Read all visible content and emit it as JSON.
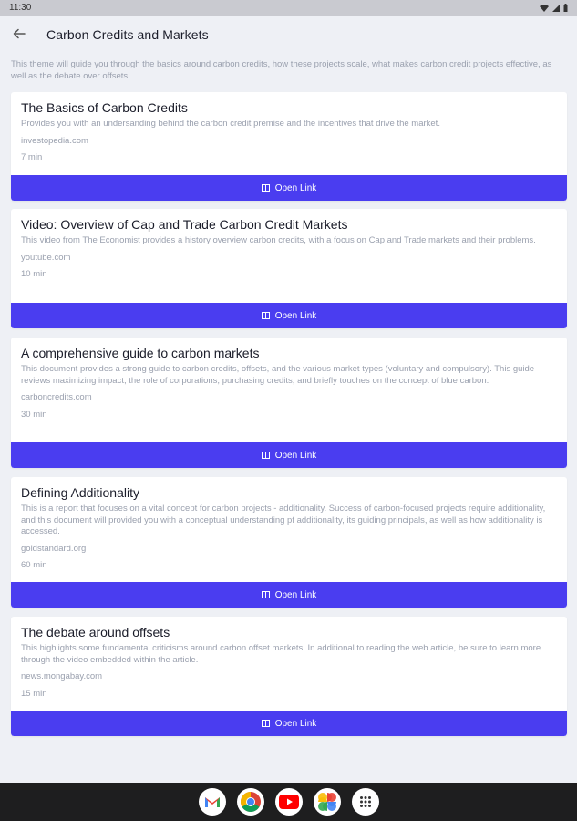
{
  "status_bar": {
    "time": "11:30"
  },
  "header": {
    "title": "Carbon Credits and Markets"
  },
  "intro": "This theme will guide you through the basics around carbon credits, how these projects scale, what makes carbon credit projects effective, as well as the debate over offsets.",
  "button_label": "Open Link",
  "cards": [
    {
      "title": "The Basics of Carbon Credits",
      "description": "Provides you with an undersanding behind the carbon credit premise and the incentives that drive the market.",
      "source": "investopedia.com",
      "time": "7 min"
    },
    {
      "title": "Video: Overview of Cap and Trade Carbon Credit Markets",
      "description": "This video from The Economist provides a history overview carbon credits, with a focus on Cap and Trade markets and their problems.",
      "source": "youtube.com",
      "time": "10 min"
    },
    {
      "title": "A comprehensive guide to carbon markets",
      "description": "This document provides a strong guide to carbon credits, offsets, and the various market types (voluntary and compulsory). This guide reviews maximizing impact, the role of corporations,  purchasing credits, and briefly touches on the concept of blue carbon.",
      "source": "carboncredits.com",
      "time": "30 min"
    },
    {
      "title": "Defining Additionality",
      "description": "This is a report that focuses on a vital concept for carbon projects - additionality. Success of carbon-focused projects require additionality, and this document will provided you with a conceptual understanding pf additionality, its guiding principals, as well as how additionality is accessed.",
      "source": "goldstandard.org",
      "time": "60 min"
    },
    {
      "title": "The debate around offsets",
      "description": "This highlights some fundamental criticisms around carbon offset markets. In additional to reading the web article, be sure to learn more through the video embedded within the article.",
      "source": "news.mongabay.com",
      "time": "15 min"
    }
  ],
  "dock": {
    "apps": [
      "gmail-icon",
      "chrome-icon",
      "youtube-icon",
      "photos-icon",
      "app-drawer-icon"
    ]
  },
  "colors": {
    "accent": "#4a3df0",
    "background": "#eef0f5",
    "muted_text": "#9aa0ae"
  }
}
